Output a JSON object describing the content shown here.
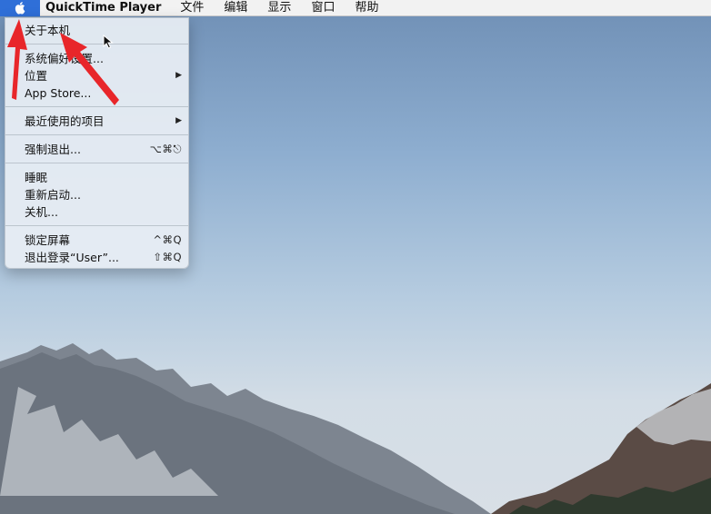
{
  "menubar": {
    "apple_icon": "apple-logo-icon",
    "app_name": "QuickTime Player",
    "items": [
      "文件",
      "编辑",
      "显示",
      "窗口",
      "帮助"
    ]
  },
  "apple_menu": {
    "about": "关于本机",
    "system_prefs": "系统偏好设置...",
    "location": "位置",
    "app_store": "App Store...",
    "recent_items": "最近使用的项目",
    "force_quit": "强制退出...",
    "force_quit_shortcut": "⌥⌘⎋",
    "sleep": "睡眠",
    "restart": "重新启动...",
    "shutdown": "关机...",
    "lock_screen": "锁定屏幕",
    "lock_screen_shortcut": "^⌘Q",
    "logout": "退出登录“User”...",
    "logout_shortcut": "⇧⌘Q",
    "submenu_icon": "triangle-right-icon"
  },
  "colors": {
    "menubar_bg": "#f2f2f2",
    "apple_highlight": "#2f6fd8",
    "annotation_arrow": "#e8262a",
    "sky_top": "#6f8fb5",
    "sky_bottom": "#d8dfe6"
  }
}
